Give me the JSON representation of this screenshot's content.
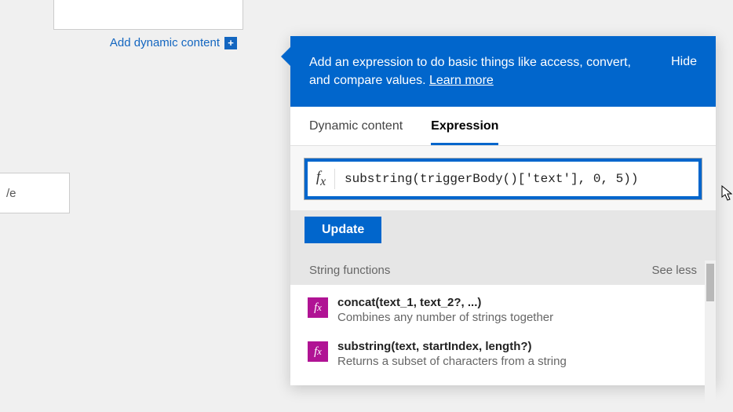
{
  "left": {
    "add_dynamic_label": "Add dynamic content",
    "save_fragment": "/e"
  },
  "flyout": {
    "blurb_text": "Add an expression to do basic things like access, convert, and compare values. ",
    "learn_more_label": "Learn more",
    "hide_label": "Hide",
    "tabs": {
      "dynamic": "Dynamic content",
      "expression": "Expression"
    },
    "expression_value": "substring(triggerBody()['text'], 0, 5))",
    "fx_symbol": "fx",
    "update_label": "Update",
    "section": {
      "title": "String functions",
      "see_less": "See less"
    },
    "functions": [
      {
        "signature": "concat(text_1, text_2?, ...)",
        "description": "Combines any number of strings together"
      },
      {
        "signature": "substring(text, startIndex, length?)",
        "description": "Returns a subset of characters from a string"
      }
    ]
  },
  "colors": {
    "primary": "#0166cc",
    "fx_badge": "#b01394"
  }
}
